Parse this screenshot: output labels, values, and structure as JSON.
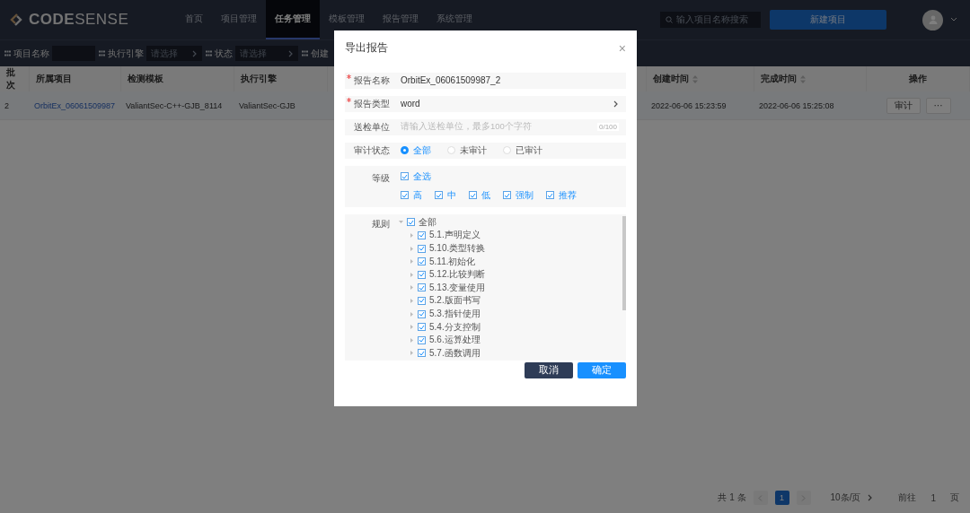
{
  "header": {
    "logo": "**CODE**SENSE",
    "nav": [
      {
        "label": "首页",
        "selected": false
      },
      {
        "label": "项目管理",
        "selected": false
      },
      {
        "label": "任务管理",
        "selected": true
      },
      {
        "label": "模板管理",
        "selected": false
      },
      {
        "label": "报告管理",
        "selected": false
      },
      {
        "label": "系统管理",
        "selected": false
      }
    ],
    "search": {
      "placeholder": "输入项目名称搜索"
    },
    "new_button": "新建项目"
  },
  "filters": [
    {
      "label": "项目名称",
      "kind": "input"
    },
    {
      "label": "执行引擎",
      "kind": "select",
      "placeholder": "请选择"
    },
    {
      "label": "状态",
      "kind": "select",
      "placeholder": "请选择"
    },
    {
      "label": "创建",
      "kind": "cut"
    }
  ],
  "table": {
    "columns": [
      {
        "label": "批次",
        "sortable": false
      },
      {
        "label": "所属项目",
        "sortable": false
      },
      {
        "label": "检测模板",
        "sortable": false
      },
      {
        "label": "执行引擎",
        "sortable": false
      },
      {},
      {
        "label": "创建时间",
        "sortable": true
      },
      {
        "label": "完成时间",
        "sortable": true
      },
      {
        "label": "操作",
        "sortable": false
      }
    ],
    "rows": [
      {
        "batch": "2",
        "project": "OrbitEx_06061509987",
        "template": "ValiantSec-C++-GJB_8114",
        "engine": "ValiantSec-GJB",
        "created": "2022-06-06 15:23:59",
        "finished": "2022-06-06 15:25:08",
        "actions": [
          "审计",
          "···"
        ]
      }
    ]
  },
  "pagination": {
    "total": "共 1 条",
    "pages": [
      {
        "label": "1",
        "selected": true
      }
    ],
    "page_size": "10条/页",
    "goto_label": "前往",
    "goto_value": "1",
    "goto_unit": "页"
  },
  "dialog": {
    "title": "导出报告",
    "close": "×",
    "fields": [
      {
        "kind": "text",
        "label": "报告名称",
        "required": true,
        "value": "OrbitEx_06061509987_2"
      },
      {
        "kind": "select",
        "label": "报告类型",
        "required": true,
        "value": "word"
      },
      {
        "kind": "input",
        "label": "送检单位",
        "required": false,
        "placeholder": "请输入送检单位，最多100个字符",
        "counter": "0/100"
      },
      {
        "kind": "radio",
        "label": "审计状态",
        "required": false,
        "options": [
          {
            "label": "全部",
            "selected": true
          },
          {
            "label": "未审计",
            "selected": false
          },
          {
            "label": "已审计",
            "selected": false
          }
        ]
      },
      {
        "kind": "checkboxes",
        "label": "等级",
        "required": false,
        "all": {
          "label": "全选",
          "checked": true
        },
        "options": [
          {
            "label": "高",
            "checked": true
          },
          {
            "label": "中",
            "checked": true
          },
          {
            "label": "低",
            "checked": true
          },
          {
            "label": "强制",
            "checked": true
          },
          {
            "label": "推荐",
            "checked": true
          }
        ]
      },
      {
        "kind": "tree",
        "label": "规则",
        "required": false,
        "tree": [
          {
            "label": "全部",
            "checked": true,
            "expanded": true,
            "children": [
              {
                "label": "5.1.声明定义",
                "checked": true,
                "expanded": false
              },
              {
                "label": "5.10.类型转换",
                "checked": true,
                "expanded": false
              },
              {
                "label": "5.11.初始化",
                "checked": true,
                "expanded": false
              },
              {
                "label": "5.12.比较判断",
                "checked": true,
                "expanded": false
              },
              {
                "label": "5.13.变量使用",
                "checked": true,
                "expanded": false
              },
              {
                "label": "5.2.版面书写",
                "checked": true,
                "expanded": false
              },
              {
                "label": "5.3.指针使用",
                "checked": true,
                "expanded": false
              },
              {
                "label": "5.4.分支控制",
                "checked": true,
                "expanded": false
              },
              {
                "label": "5.6.运算处理",
                "checked": true,
                "expanded": false
              },
              {
                "label": "5.7.函数调用",
                "checked": true,
                "expanded": false
              }
            ]
          }
        ]
      }
    ],
    "buttons": [
      {
        "label": "取消",
        "kind": "secondary"
      },
      {
        "label": "确定",
        "kind": "primary"
      }
    ]
  }
}
